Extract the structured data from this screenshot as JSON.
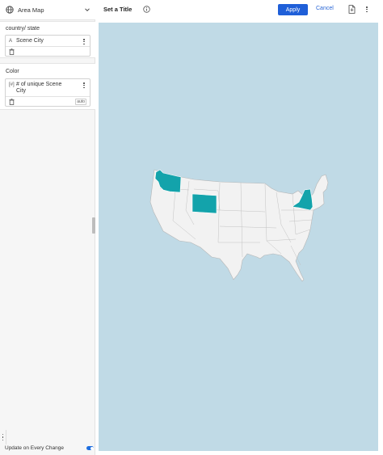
{
  "viz_type": {
    "label": "Area Map",
    "icon": "globe-icon"
  },
  "sections": [
    {
      "title": "country/ state",
      "field": {
        "type_label": "A",
        "text": "Scene City"
      },
      "auto": ""
    },
    {
      "title": "Color",
      "field": {
        "type_label": "[#]",
        "text": "# of unique Scene City"
      },
      "auto": "auto"
    }
  ],
  "footer": {
    "update_label": "Update on Every Change",
    "update_enabled": true
  },
  "toolbar": {
    "title": "Set a Title",
    "apply_label": "Apply",
    "cancel_label": "Cancel"
  },
  "map": {
    "ocean_color": "#c0dae6",
    "land_color": "#f2f2f2",
    "highlight_color": "#13a3ab",
    "highlighted_states": [
      "Washington",
      "Wyoming",
      "New York"
    ]
  }
}
